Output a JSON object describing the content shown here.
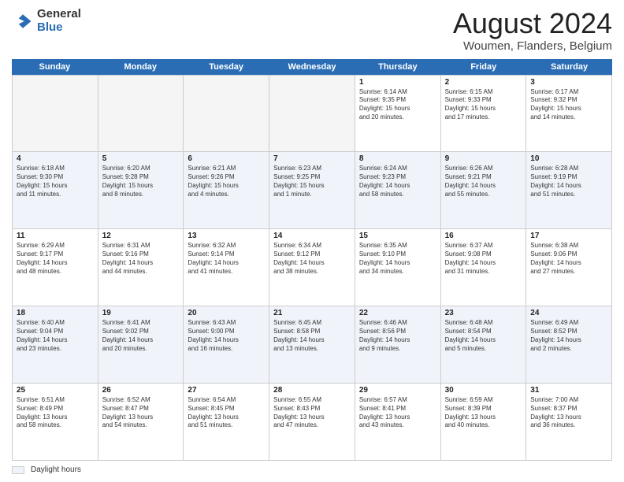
{
  "logo": {
    "general": "General",
    "blue": "Blue"
  },
  "title": "August 2024",
  "subtitle": "Woumen, Flanders, Belgium",
  "days_of_week": [
    "Sunday",
    "Monday",
    "Tuesday",
    "Wednesday",
    "Thursday",
    "Friday",
    "Saturday"
  ],
  "footer_legend": "Daylight hours",
  "weeks": [
    [
      {
        "num": "",
        "info": "",
        "empty": true
      },
      {
        "num": "",
        "info": "",
        "empty": true
      },
      {
        "num": "",
        "info": "",
        "empty": true
      },
      {
        "num": "",
        "info": "",
        "empty": true
      },
      {
        "num": "1",
        "info": "Sunrise: 6:14 AM\nSunset: 9:35 PM\nDaylight: 15 hours\nand 20 minutes.",
        "empty": false
      },
      {
        "num": "2",
        "info": "Sunrise: 6:15 AM\nSunset: 9:33 PM\nDaylight: 15 hours\nand 17 minutes.",
        "empty": false
      },
      {
        "num": "3",
        "info": "Sunrise: 6:17 AM\nSunset: 9:32 PM\nDaylight: 15 hours\nand 14 minutes.",
        "empty": false
      }
    ],
    [
      {
        "num": "4",
        "info": "Sunrise: 6:18 AM\nSunset: 9:30 PM\nDaylight: 15 hours\nand 11 minutes.",
        "empty": false
      },
      {
        "num": "5",
        "info": "Sunrise: 6:20 AM\nSunset: 9:28 PM\nDaylight: 15 hours\nand 8 minutes.",
        "empty": false
      },
      {
        "num": "6",
        "info": "Sunrise: 6:21 AM\nSunset: 9:26 PM\nDaylight: 15 hours\nand 4 minutes.",
        "empty": false
      },
      {
        "num": "7",
        "info": "Sunrise: 6:23 AM\nSunset: 9:25 PM\nDaylight: 15 hours\nand 1 minute.",
        "empty": false
      },
      {
        "num": "8",
        "info": "Sunrise: 6:24 AM\nSunset: 9:23 PM\nDaylight: 14 hours\nand 58 minutes.",
        "empty": false
      },
      {
        "num": "9",
        "info": "Sunrise: 6:26 AM\nSunset: 9:21 PM\nDaylight: 14 hours\nand 55 minutes.",
        "empty": false
      },
      {
        "num": "10",
        "info": "Sunrise: 6:28 AM\nSunset: 9:19 PM\nDaylight: 14 hours\nand 51 minutes.",
        "empty": false
      }
    ],
    [
      {
        "num": "11",
        "info": "Sunrise: 6:29 AM\nSunset: 9:17 PM\nDaylight: 14 hours\nand 48 minutes.",
        "empty": false
      },
      {
        "num": "12",
        "info": "Sunrise: 6:31 AM\nSunset: 9:16 PM\nDaylight: 14 hours\nand 44 minutes.",
        "empty": false
      },
      {
        "num": "13",
        "info": "Sunrise: 6:32 AM\nSunset: 9:14 PM\nDaylight: 14 hours\nand 41 minutes.",
        "empty": false
      },
      {
        "num": "14",
        "info": "Sunrise: 6:34 AM\nSunset: 9:12 PM\nDaylight: 14 hours\nand 38 minutes.",
        "empty": false
      },
      {
        "num": "15",
        "info": "Sunrise: 6:35 AM\nSunset: 9:10 PM\nDaylight: 14 hours\nand 34 minutes.",
        "empty": false
      },
      {
        "num": "16",
        "info": "Sunrise: 6:37 AM\nSunset: 9:08 PM\nDaylight: 14 hours\nand 31 minutes.",
        "empty": false
      },
      {
        "num": "17",
        "info": "Sunrise: 6:38 AM\nSunset: 9:06 PM\nDaylight: 14 hours\nand 27 minutes.",
        "empty": false
      }
    ],
    [
      {
        "num": "18",
        "info": "Sunrise: 6:40 AM\nSunset: 9:04 PM\nDaylight: 14 hours\nand 23 minutes.",
        "empty": false
      },
      {
        "num": "19",
        "info": "Sunrise: 6:41 AM\nSunset: 9:02 PM\nDaylight: 14 hours\nand 20 minutes.",
        "empty": false
      },
      {
        "num": "20",
        "info": "Sunrise: 6:43 AM\nSunset: 9:00 PM\nDaylight: 14 hours\nand 16 minutes.",
        "empty": false
      },
      {
        "num": "21",
        "info": "Sunrise: 6:45 AM\nSunset: 8:58 PM\nDaylight: 14 hours\nand 13 minutes.",
        "empty": false
      },
      {
        "num": "22",
        "info": "Sunrise: 6:46 AM\nSunset: 8:56 PM\nDaylight: 14 hours\nand 9 minutes.",
        "empty": false
      },
      {
        "num": "23",
        "info": "Sunrise: 6:48 AM\nSunset: 8:54 PM\nDaylight: 14 hours\nand 5 minutes.",
        "empty": false
      },
      {
        "num": "24",
        "info": "Sunrise: 6:49 AM\nSunset: 8:52 PM\nDaylight: 14 hours\nand 2 minutes.",
        "empty": false
      }
    ],
    [
      {
        "num": "25",
        "info": "Sunrise: 6:51 AM\nSunset: 8:49 PM\nDaylight: 13 hours\nand 58 minutes.",
        "empty": false
      },
      {
        "num": "26",
        "info": "Sunrise: 6:52 AM\nSunset: 8:47 PM\nDaylight: 13 hours\nand 54 minutes.",
        "empty": false
      },
      {
        "num": "27",
        "info": "Sunrise: 6:54 AM\nSunset: 8:45 PM\nDaylight: 13 hours\nand 51 minutes.",
        "empty": false
      },
      {
        "num": "28",
        "info": "Sunrise: 6:55 AM\nSunset: 8:43 PM\nDaylight: 13 hours\nand 47 minutes.",
        "empty": false
      },
      {
        "num": "29",
        "info": "Sunrise: 6:57 AM\nSunset: 8:41 PM\nDaylight: 13 hours\nand 43 minutes.",
        "empty": false
      },
      {
        "num": "30",
        "info": "Sunrise: 6:59 AM\nSunset: 8:39 PM\nDaylight: 13 hours\nand 40 minutes.",
        "empty": false
      },
      {
        "num": "31",
        "info": "Sunrise: 7:00 AM\nSunset: 8:37 PM\nDaylight: 13 hours\nand 36 minutes.",
        "empty": false
      }
    ]
  ]
}
